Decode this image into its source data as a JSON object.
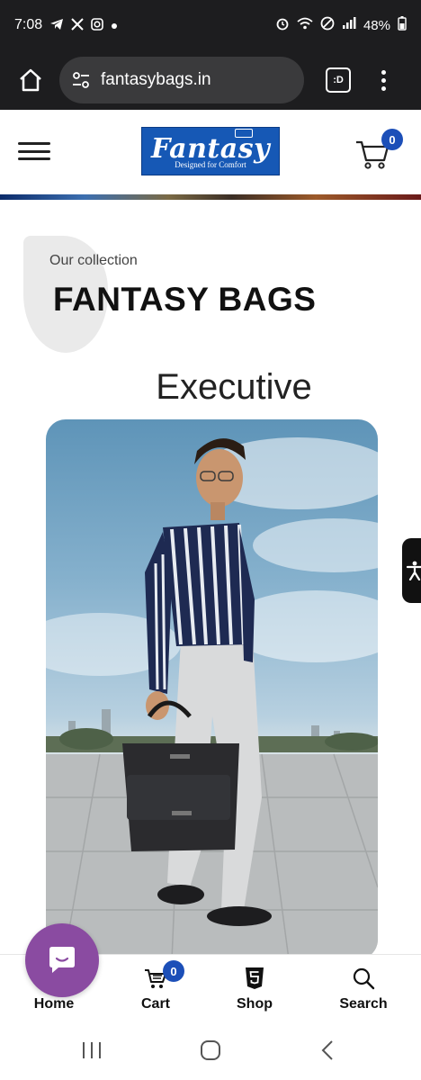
{
  "status_bar": {
    "time": "7:08",
    "left_icons": [
      "telegram-icon",
      "x-icon",
      "instagram-icon",
      "dot-icon"
    ],
    "right_icons": [
      "alarm-icon",
      "wifi-icon",
      "dnd-icon",
      "signal-icon"
    ],
    "battery": "48%"
  },
  "browser": {
    "url": "fantasybags.in",
    "tabs_label": ":D"
  },
  "header": {
    "logo_text": "Fantasy",
    "logo_tagline": "Designed for Comfort",
    "cart_count": "0"
  },
  "collection": {
    "kicker": "Our collection",
    "title": "FANTASY BAGS",
    "category": "Executive"
  },
  "bottom_nav": {
    "items": [
      {
        "label": "Home",
        "icon": "home-icon"
      },
      {
        "label": "Cart",
        "icon": "cart-icon"
      },
      {
        "label": "Shop",
        "icon": "html5-icon"
      },
      {
        "label": "Search",
        "icon": "search-icon"
      }
    ],
    "cart_badge": "0"
  },
  "colors": {
    "accent": "#1c4fb8",
    "chat": "#8a4ba1",
    "chrome_bar": "#1d1d1f"
  }
}
